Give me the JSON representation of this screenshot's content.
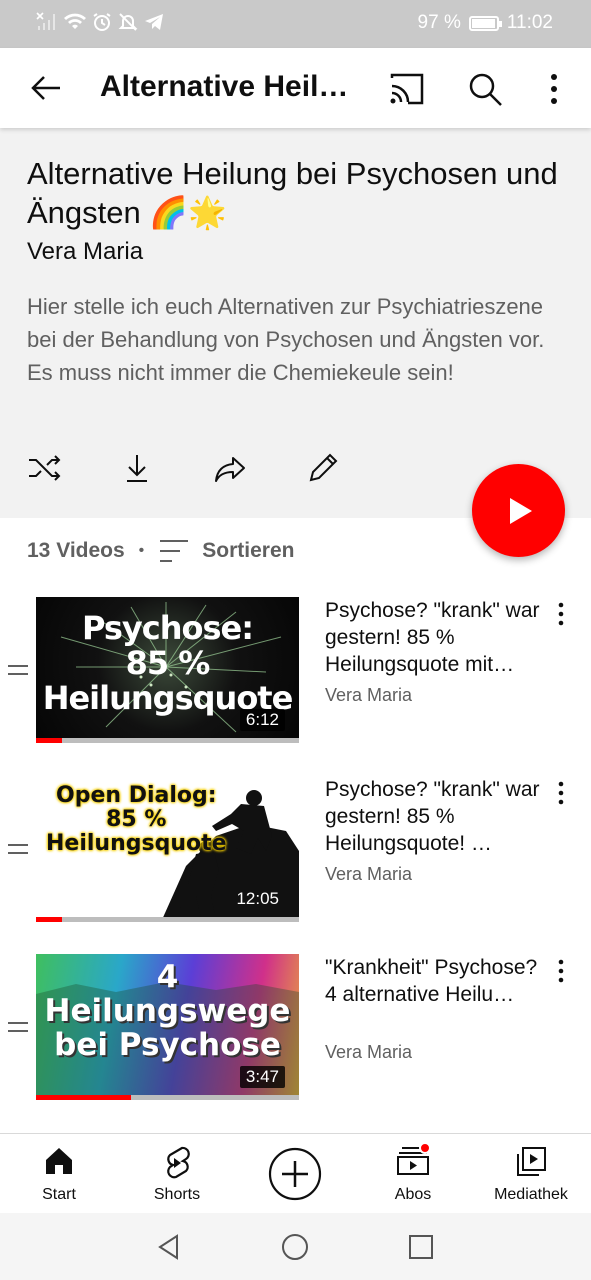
{
  "status_bar": {
    "battery_percent": "97 %",
    "battery_level": 0.97,
    "time": "11:02"
  },
  "app_bar": {
    "title": "Alternative Heilung bei Psychosen und Ängsten"
  },
  "playlist": {
    "title": "Alternative Heilung bei Psychosen und Ängsten 🌈🌟",
    "owner": "Vera Maria",
    "description": "Hier stelle ich euch Alternativen zur Psychiatrieszene bei der Behandlung von Psychosen und Ängsten vor. Es muss nicht immer die Chemiekeule sein!",
    "video_count": "13 Videos",
    "sort_label": "Sortieren"
  },
  "videos": [
    {
      "thumb_text": [
        "Psychose:",
        "85 %",
        "Heilungsquote"
      ],
      "duration": "6:12",
      "progress": 0.1,
      "title": "Psychose?  \"krank\" war gestern! 85 % Heilungsquote mit…",
      "channel": "Vera Maria"
    },
    {
      "thumb_text": [
        "Open Dialog:",
        "85 %",
        "Heilungsquote"
      ],
      "duration": "12:05",
      "progress": 0.1,
      "title": "Psychose?  \"krank\" war gestern! 85 % Heilungsquote! …",
      "channel": "Vera Maria"
    },
    {
      "thumb_text": [
        "4",
        "Heilungswege",
        "bei Psychose"
      ],
      "duration": "3:47",
      "progress": 0.36,
      "title": "\"Krankheit\" Psychose? 4 alternative Heilu…",
      "channel": "Vera Maria"
    }
  ],
  "bottom_nav": {
    "items": [
      {
        "label": "Start",
        "icon": "home-icon"
      },
      {
        "label": "Shorts",
        "icon": "shorts-icon"
      },
      {
        "label": "",
        "icon": "create-icon"
      },
      {
        "label": "Abos",
        "icon": "subscriptions-icon"
      },
      {
        "label": "Mediathek",
        "icon": "library-icon"
      }
    ]
  },
  "colors": {
    "accent": "#ff0000",
    "header_bg": "#f2f2f2",
    "secondary_text": "#606060"
  }
}
